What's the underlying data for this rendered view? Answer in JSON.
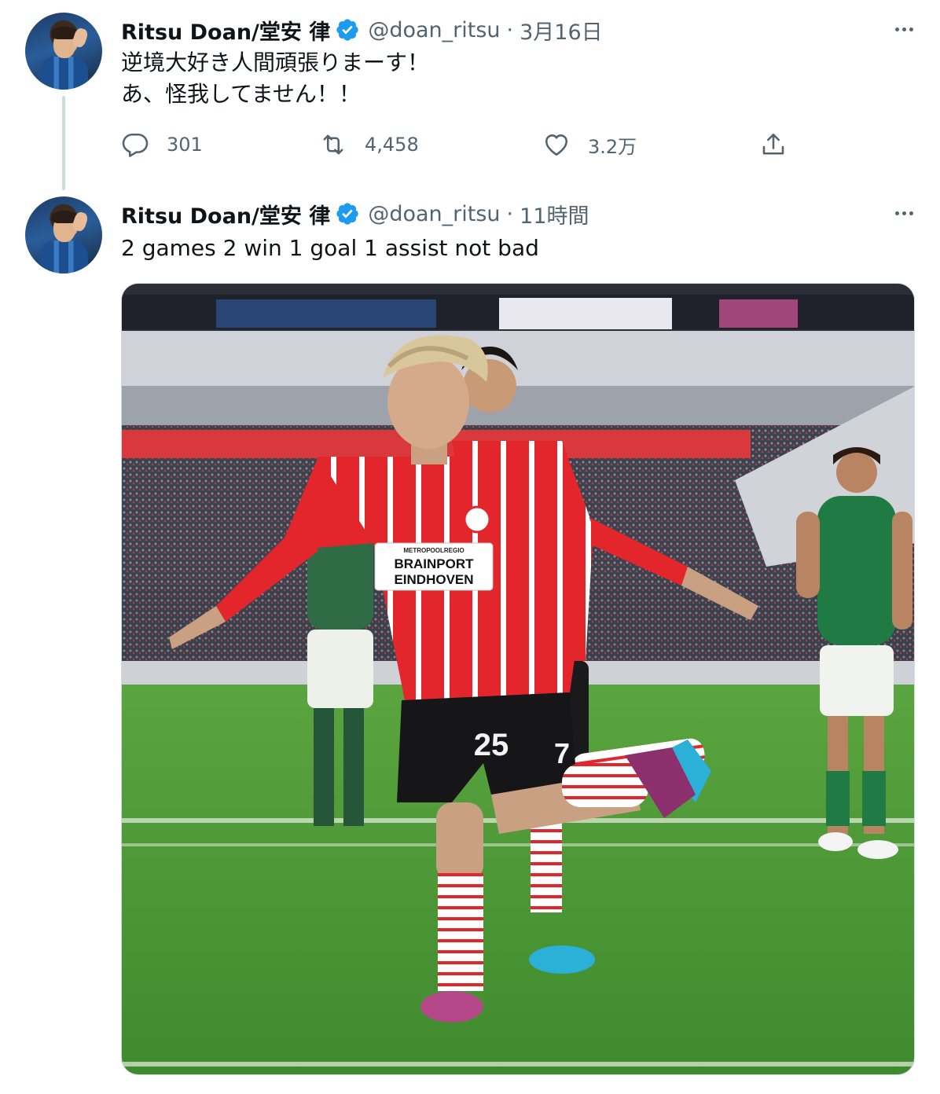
{
  "tweets": [
    {
      "name": "Ritsu Doan/堂安 律",
      "handle": "@doan_ritsu",
      "separator": "·",
      "time": "3月16日",
      "text_lines": [
        "逆境大好き人間頑張りまーす！",
        "あ、怪我してません！！"
      ],
      "actions": {
        "replies": "301",
        "retweets": "4,458",
        "likes": "3.2万"
      }
    },
    {
      "name": "Ritsu Doan/堂安 律",
      "handle": "@doan_ritsu",
      "separator": "·",
      "time": "11時間",
      "text_lines": [
        "2 games 2 win 1 goal 1 assist not bad"
      ]
    }
  ],
  "media": {
    "jersey_sponsor_small": "METROPOOLREGIO",
    "jersey_sponsor_line1": "BRAINPORT",
    "jersey_sponsor_line2": "EINDHOVEN",
    "jersey_number_front": "25",
    "jersey_number_back": "7"
  },
  "colors": {
    "verified": "#1d9bf0",
    "secondary_text": "#536471",
    "psv_red": "#e3262b",
    "pitch_green": "#4f9b3a"
  },
  "icons": [
    "verified-badge-icon",
    "more-icon",
    "reply-icon",
    "retweet-icon",
    "like-icon",
    "share-icon"
  ]
}
